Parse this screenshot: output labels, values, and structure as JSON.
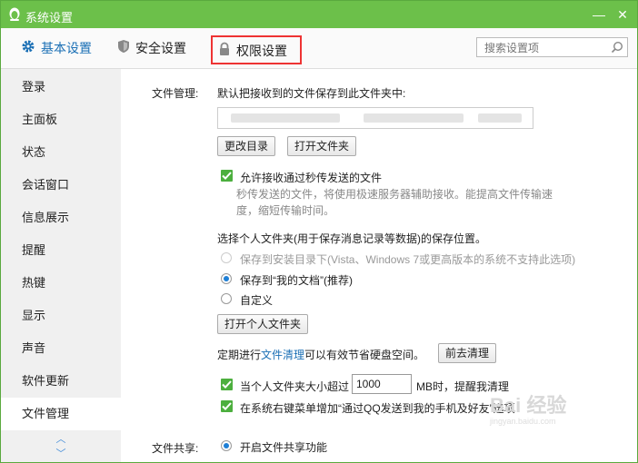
{
  "window": {
    "title": "系统设置",
    "minimize": "—",
    "close": "✕"
  },
  "tabs": [
    {
      "label": "基本设置",
      "icon": "gear-icon",
      "color": "#1a6fb5"
    },
    {
      "label": "安全设置",
      "icon": "shield-icon"
    },
    {
      "label": "权限设置",
      "icon": "lock-icon",
      "highlight": "#ee3333"
    }
  ],
  "search": {
    "placeholder": "搜索设置项"
  },
  "sidebar": {
    "items": [
      "登录",
      "主面板",
      "状态",
      "会话窗口",
      "信息展示",
      "提醒",
      "热键",
      "显示",
      "声音",
      "软件更新",
      "文件管理"
    ],
    "active": "文件管理"
  },
  "file_mgmt": {
    "section_label": "文件管理:",
    "save_path_label": "默认把接收到的文件保存到此文件夹中:",
    "change_dir_button": "更改目录",
    "open_folder_button": "打开文件夹",
    "allow_flash_label": "允许接收通过秒传发送的文件",
    "allow_flash_checked": true,
    "flash_desc_1": "秒传发送的文件，将使用极速服务器辅助接收。能提高文件传输速",
    "flash_desc_2": "度，缩短传输时间。",
    "personal_folder_label": "选择个人文件夹(用于保存消息记录等数据)的保存位置。",
    "opt_install_dir": "保存到安装目录下(Vista、Windows 7或更高版本的系统不支持此选项)",
    "opt_my_docs": "保存到“我的文档”(推荐)",
    "opt_custom": "自定义",
    "selected_option": "保存到“我的文档”(推荐)",
    "open_personal_button": "打开个人文件夹",
    "cleanup_prefix": "定期进行",
    "cleanup_link": "文件清理",
    "cleanup_suffix": "可以有效节省硬盘空间。",
    "cleanup_button": "前去清理",
    "size_check_label": "当个人文件夹大小超过",
    "size_value": "1000",
    "size_unit_label": "MB时，提醒我清理",
    "size_check_checked": true,
    "context_menu_label": "在系统右键菜单增加“通过QQ发送到我的手机及好友”选项",
    "context_menu_checked": true
  },
  "file_share": {
    "section_label": "文件共享:",
    "enable_label": "开启文件共享功能",
    "enabled": true
  },
  "watermark": {
    "text": "Bai 经验",
    "sub": "jingyan.baidu.com"
  }
}
